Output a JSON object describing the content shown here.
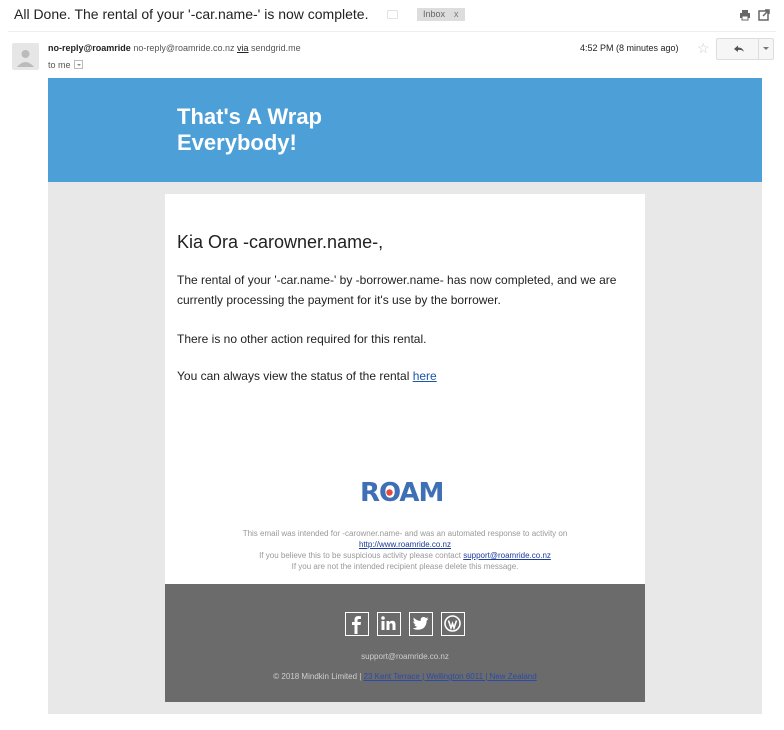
{
  "message": {
    "subject": "All Done. The rental of your '-car.name-' is now complete.",
    "label": "Inbox",
    "label_remove": "x",
    "sender_name": "no-reply@roamride",
    "sender_email": "no-reply@roamride.co.nz",
    "via_label": "via",
    "via_domain": "sendgrid.me",
    "recipient": "to me",
    "timestamp": "4:52 PM (8 minutes ago)"
  },
  "email": {
    "banner_line1": "That's A Wrap",
    "banner_line2": "Everybody!",
    "greeting": "Kia Ora -carowner.name-,",
    "para1": "The rental of your '-car.name-' by -borrower.name- has now completed, and we are currently processing the payment for it's use by the borrower.",
    "para2": "There is no other action required for this rental.",
    "para3_prefix": "You can always view the status of the rental ",
    "para3_link": "here",
    "logo_text": "ROAM",
    "footer_line1": "This email was intended for -carowner.name- and was an automated response to activity on",
    "footer_link": "http://www.roamride.co.nz",
    "footer_line3_prefix": "If you believe this to be suspicious activity please contact ",
    "footer_support_link": "support@roamride.co.nz",
    "footer_line4": "If you are not the intended recipient please delete this message.",
    "support_email": "support@roamride.co.nz",
    "copyright": "© 2018 Mindkin Limited | ",
    "address_link": "23 Kent Terrace | Wellington 6011 | New Zealand"
  },
  "colors": {
    "banner": "#4d9fd8",
    "dark_footer": "#6b6b6b",
    "logo": "#3f6fb5",
    "logo_accent": "#e8473c"
  },
  "icons": [
    "print-icon",
    "new-window-icon",
    "star-icon",
    "reply-icon",
    "facebook-icon",
    "linkedin-icon",
    "twitter-icon",
    "wordpress-icon"
  ]
}
